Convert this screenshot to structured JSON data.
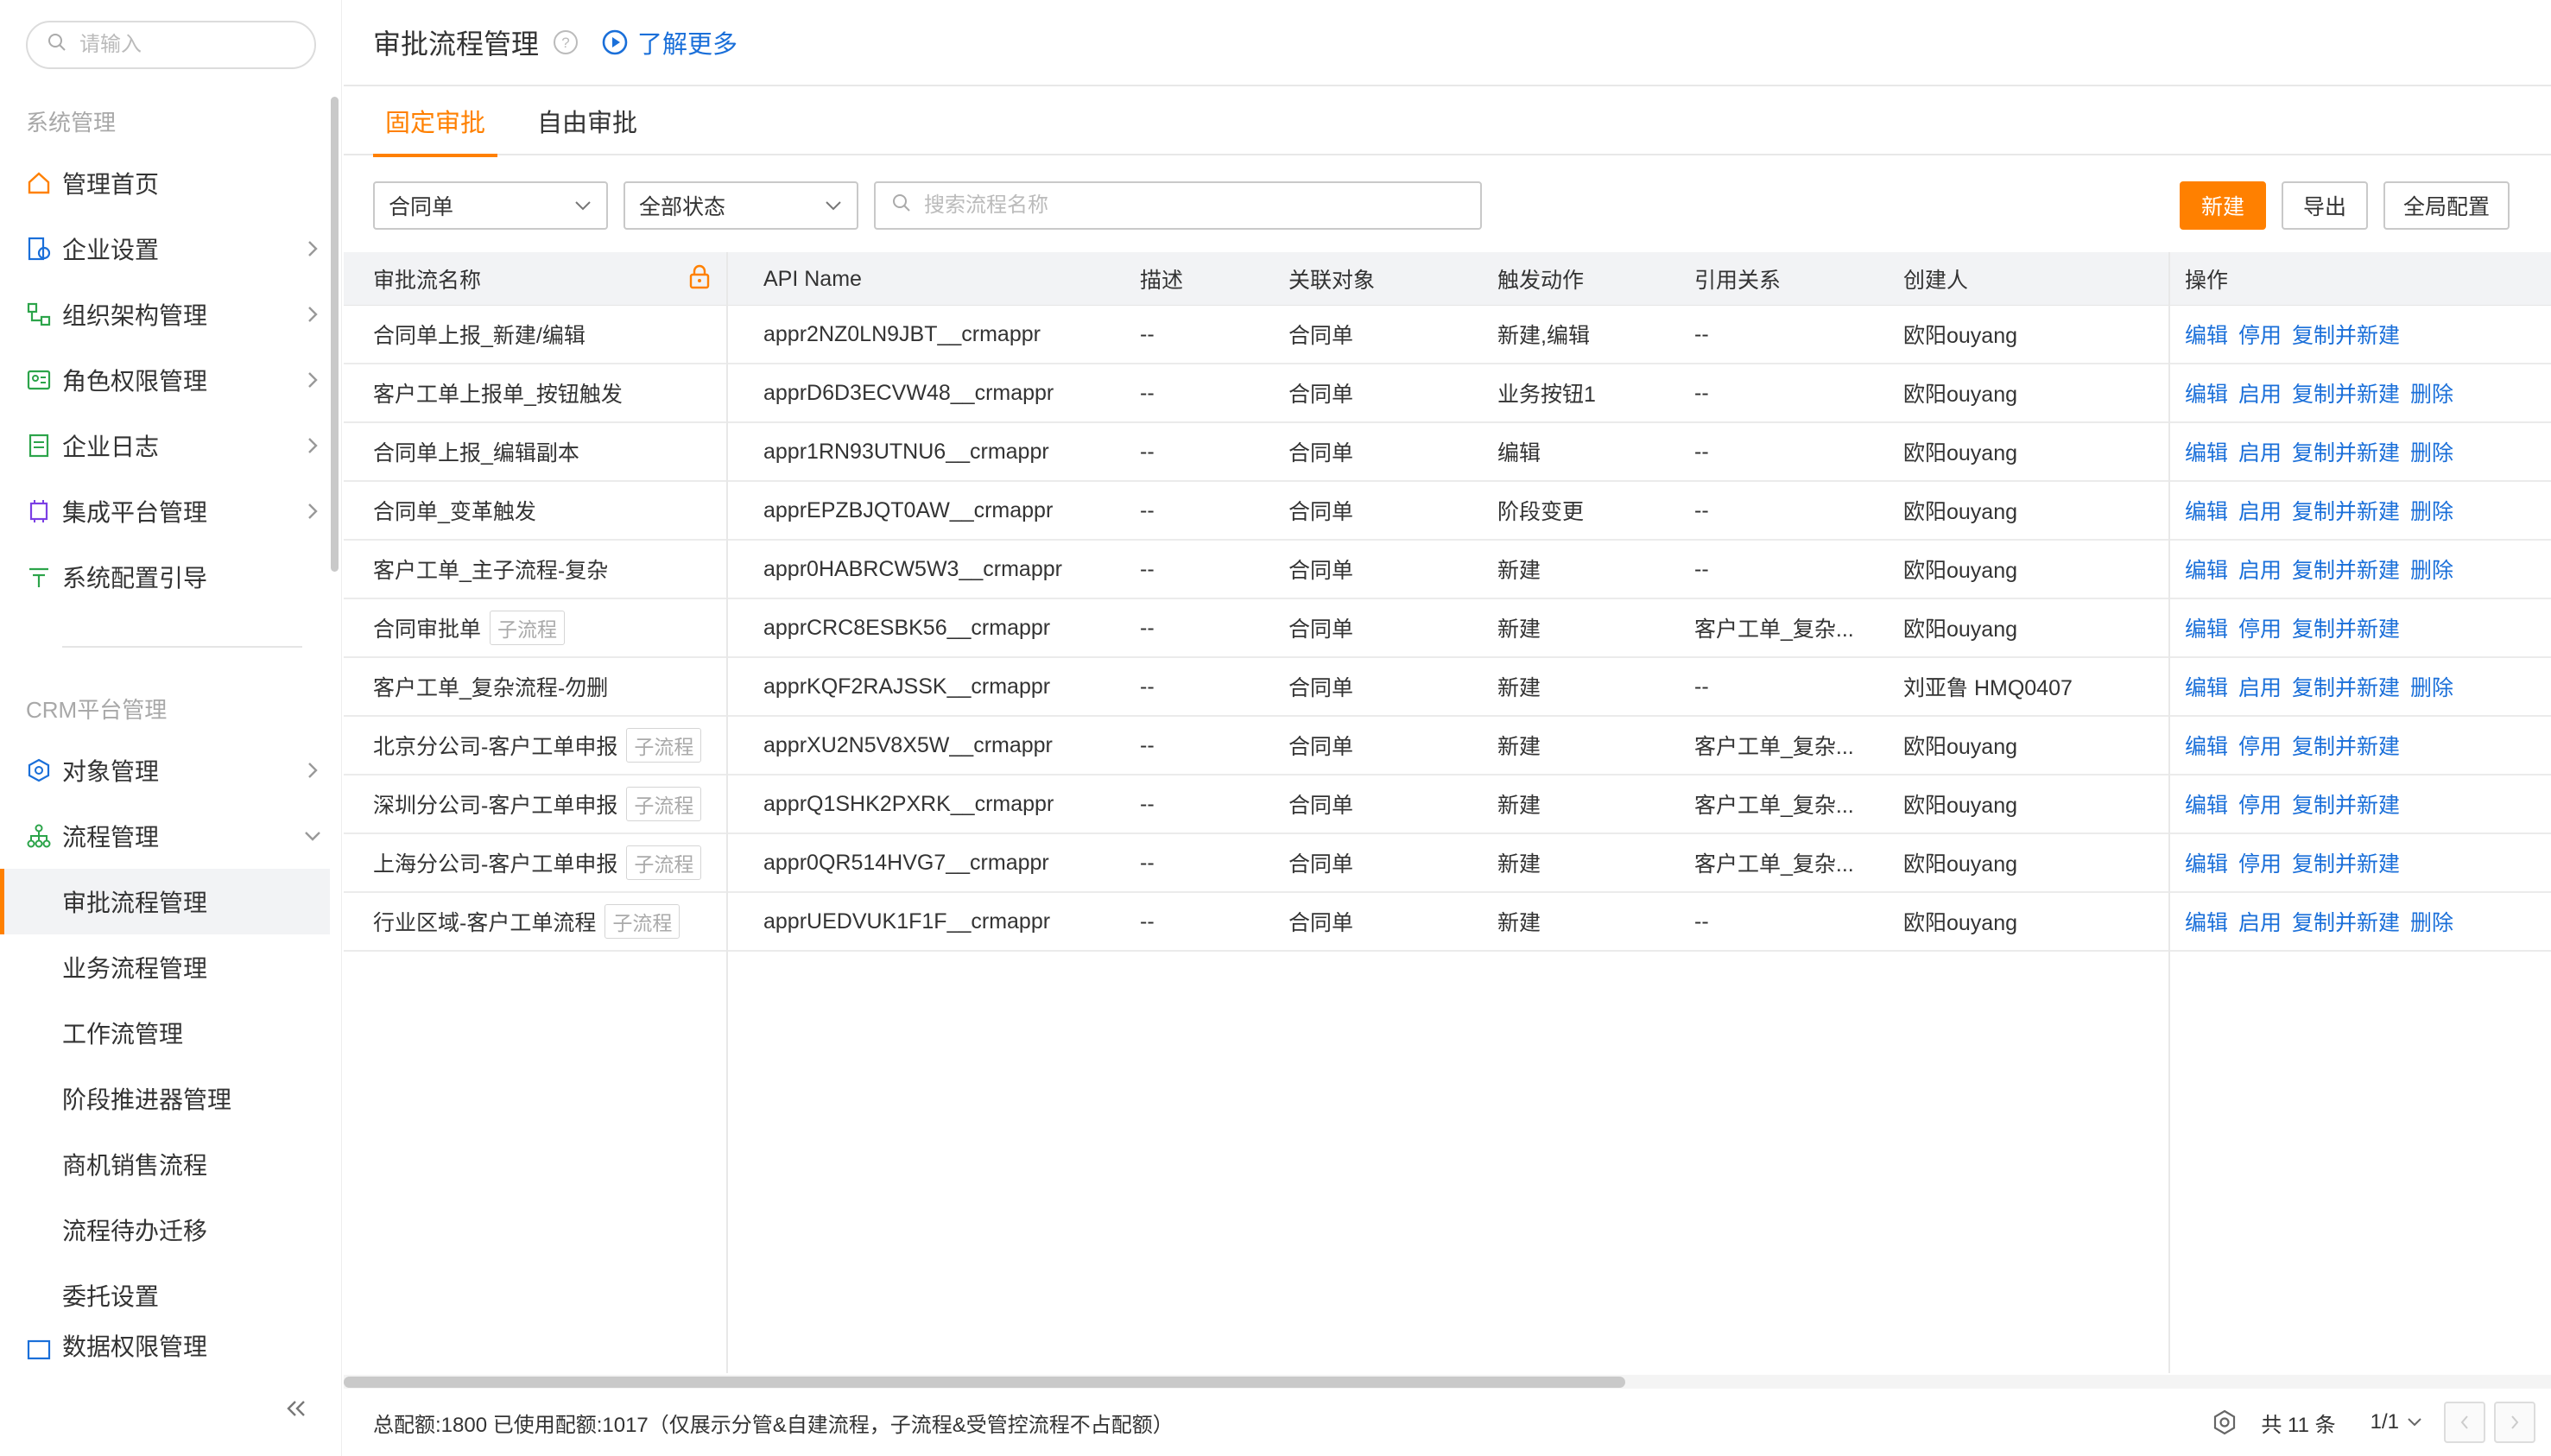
{
  "sidebar": {
    "search_placeholder": "请输入",
    "section_system": "系统管理",
    "items": [
      {
        "label": "管理首页",
        "icon": "home-icon"
      },
      {
        "label": "企业设置",
        "icon": "company-settings-icon"
      },
      {
        "label": "组织架构管理",
        "icon": "org-structure-icon"
      },
      {
        "label": "角色权限管理",
        "icon": "role-permission-icon"
      },
      {
        "label": "企业日志",
        "icon": "log-icon"
      },
      {
        "label": "集成平台管理",
        "icon": "integration-icon"
      },
      {
        "label": "系统配置引导",
        "icon": "config-guide-icon"
      }
    ],
    "section_crm": "CRM平台管理",
    "crm_items": [
      {
        "label": "对象管理",
        "icon": "object-icon"
      },
      {
        "label": "流程管理",
        "icon": "flow-icon"
      }
    ],
    "flow_sub_items": [
      {
        "label": "审批流程管理"
      },
      {
        "label": "业务流程管理"
      },
      {
        "label": "工作流管理"
      },
      {
        "label": "阶段推进器管理"
      },
      {
        "label": "商机销售流程"
      },
      {
        "label": "流程待办迁移"
      },
      {
        "label": "委托设置"
      }
    ],
    "partial_item": "数据权限管理",
    "colors": {
      "icon": "#ff8000",
      "active_border": "#ff8000"
    }
  },
  "header": {
    "title": "审批流程管理",
    "learn_more": "了解更多"
  },
  "tabs": [
    {
      "label": "固定审批",
      "active": true
    },
    {
      "label": "自由审批",
      "active": false
    }
  ],
  "filters": {
    "object_select": "合同单",
    "status_select": "全部状态",
    "search_placeholder": "搜索流程名称"
  },
  "toolbar": {
    "new_label": "新建",
    "export_label": "导出",
    "global_config_label": "全局配置"
  },
  "table": {
    "columns": [
      "审批流名称",
      "API Name",
      "描述",
      "关联对象",
      "触发动作",
      "引用关系",
      "创建人",
      "操作"
    ],
    "rows": [
      {
        "name": "合同单上报_新建/编辑",
        "tag": "",
        "api": "appr2NZ0LN9JBT__crmappr",
        "desc": "--",
        "obj": "合同单",
        "trigger": "新建,编辑",
        "ref": "--",
        "creator": "欧阳ouyang",
        "ops": [
          "编辑",
          "停用",
          "复制并新建"
        ]
      },
      {
        "name": "客户工单上报单_按钮触发",
        "tag": "",
        "api": "apprD6D3ECVW48__crmappr",
        "desc": "--",
        "obj": "合同单",
        "trigger": "业务按钮1",
        "ref": "--",
        "creator": "欧阳ouyang",
        "ops": [
          "编辑",
          "启用",
          "复制并新建",
          "删除"
        ]
      },
      {
        "name": "合同单上报_编辑副本",
        "tag": "",
        "api": "appr1RN93UTNU6__crmappr",
        "desc": "--",
        "obj": "合同单",
        "trigger": "编辑",
        "ref": "--",
        "creator": "欧阳ouyang",
        "ops": [
          "编辑",
          "启用",
          "复制并新建",
          "删除"
        ]
      },
      {
        "name": "合同单_变革触发",
        "tag": "",
        "api": "apprEPZBJQT0AW__crmappr",
        "desc": "--",
        "obj": "合同单",
        "trigger": "阶段变更",
        "ref": "--",
        "creator": "欧阳ouyang",
        "ops": [
          "编辑",
          "启用",
          "复制并新建",
          "删除"
        ]
      },
      {
        "name": "客户工单_主子流程-复杂",
        "tag": "",
        "api": "appr0HABRCW5W3__crmappr",
        "desc": "--",
        "obj": "合同单",
        "trigger": "新建",
        "ref": "--",
        "creator": "欧阳ouyang",
        "ops": [
          "编辑",
          "启用",
          "复制并新建",
          "删除"
        ]
      },
      {
        "name": "合同审批单",
        "tag": "子流程",
        "api": "apprCRC8ESBK56__crmappr",
        "desc": "--",
        "obj": "合同单",
        "trigger": "新建",
        "ref": "客户工单_复杂...",
        "creator": "欧阳ouyang",
        "ops": [
          "编辑",
          "停用",
          "复制并新建"
        ]
      },
      {
        "name": "客户工单_复杂流程-勿删",
        "tag": "",
        "api": "apprKQF2RAJSSK__crmappr",
        "desc": "--",
        "obj": "合同单",
        "trigger": "新建",
        "ref": "--",
        "creator": "刘亚鲁 HMQ0407",
        "ops": [
          "编辑",
          "启用",
          "复制并新建",
          "删除"
        ]
      },
      {
        "name": "北京分公司-客户工单申报",
        "tag": "子流程",
        "api": "apprXU2N5V8X5W__crmappr",
        "desc": "--",
        "obj": "合同单",
        "trigger": "新建",
        "ref": "客户工单_复杂...",
        "creator": "欧阳ouyang",
        "ops": [
          "编辑",
          "停用",
          "复制并新建"
        ]
      },
      {
        "name": "深圳分公司-客户工单申报",
        "tag": "子流程",
        "api": "apprQ1SHK2PXRK__crmappr",
        "desc": "--",
        "obj": "合同单",
        "trigger": "新建",
        "ref": "客户工单_复杂...",
        "creator": "欧阳ouyang",
        "ops": [
          "编辑",
          "停用",
          "复制并新建"
        ]
      },
      {
        "name": "上海分公司-客户工单申报",
        "tag": "子流程",
        "api": "appr0QR514HVG7__crmappr",
        "desc": "--",
        "obj": "合同单",
        "trigger": "新建",
        "ref": "客户工单_复杂...",
        "creator": "欧阳ouyang",
        "ops": [
          "编辑",
          "停用",
          "复制并新建"
        ]
      },
      {
        "name": "行业区域-客户工单流程",
        "tag": "子流程",
        "api": "apprUEDVUK1F1F__crmappr",
        "desc": "--",
        "obj": "合同单",
        "trigger": "新建",
        "ref": "--",
        "creator": "欧阳ouyang",
        "ops": [
          "编辑",
          "启用",
          "复制并新建",
          "删除"
        ]
      }
    ]
  },
  "footer": {
    "quota": "总配额:1800 已使用配额:1017（仅展示分管&自建流程，子流程&受管控流程不占配额）",
    "total": "共 11 条",
    "page": "1/1"
  },
  "colors": {
    "accent": "#ff8000",
    "link": "#1a6fd9"
  }
}
